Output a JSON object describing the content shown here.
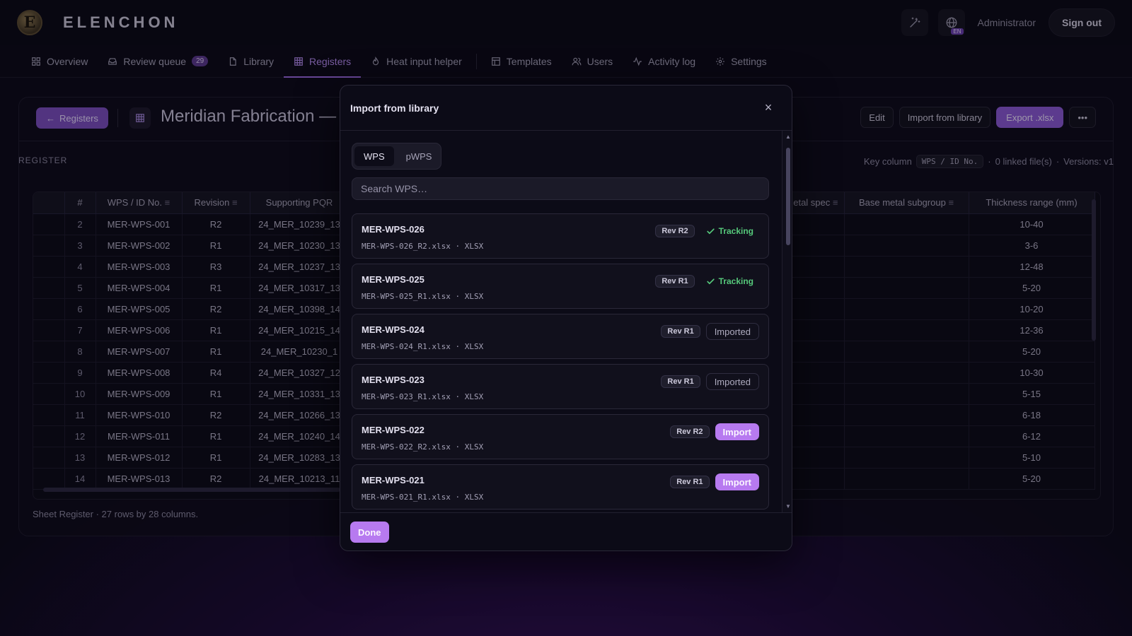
{
  "app": {
    "brand": "ELENCHON",
    "logo_letter": "E"
  },
  "topbar": {
    "lang_badge": "EN",
    "user": "Administrator",
    "sign_out": "Sign out"
  },
  "nav": {
    "overview": "Overview",
    "review_queue": "Review queue",
    "review_count": "29",
    "library": "Library",
    "registers": "Registers",
    "heat_input": "Heat input helper",
    "templates": "Templates",
    "users": "Users",
    "activity": "Activity log",
    "settings": "Settings"
  },
  "page": {
    "back": "Registers",
    "title": "Meridian Fabrication —",
    "edit": "Edit",
    "import_lib": "Import from library",
    "export": "Export .xlsx",
    "more": "•••",
    "register_label": "REGISTER",
    "key_column_label": "Key column",
    "key_column": "WPS / ID No.",
    "linked": "0 linked file(s)",
    "versions": "Versions: v1",
    "sheet_info": "Sheet Register · 27 rows by 28 columns."
  },
  "table": {
    "headers": [
      "#",
      "WPS / ID No.",
      "Revision",
      "Supporting PQR"
    ],
    "right_headers": [
      "etal spec",
      "Base metal subgroup",
      "Thickness range (mm)"
    ],
    "rows": [
      [
        "2",
        "MER-WPS-001",
        "R2",
        "24_MER_10239_13",
        "10-40"
      ],
      [
        "3",
        "MER-WPS-002",
        "R1",
        "24_MER_10230_13",
        "3-6"
      ],
      [
        "4",
        "MER-WPS-003",
        "R3",
        "24_MER_10237_13",
        "12-48"
      ],
      [
        "5",
        "MER-WPS-004",
        "R1",
        "24_MER_10317_13",
        "5-20"
      ],
      [
        "6",
        "MER-WPS-005",
        "R2",
        "24_MER_10398_14",
        "10-20"
      ],
      [
        "7",
        "MER-WPS-006",
        "R1",
        "24_MER_10215_14",
        "12-36"
      ],
      [
        "8",
        "MER-WPS-007",
        "R1",
        "24_MER_10230_1",
        "5-20"
      ],
      [
        "9",
        "MER-WPS-008",
        "R4",
        "24_MER_10327_12",
        "10-30"
      ],
      [
        "10",
        "MER-WPS-009",
        "R1",
        "24_MER_10331_13",
        "5-15"
      ],
      [
        "11",
        "MER-WPS-010",
        "R2",
        "24_MER_10266_13",
        "6-18"
      ],
      [
        "12",
        "MER-WPS-011",
        "R1",
        "24_MER_10240_14",
        "6-12"
      ],
      [
        "13",
        "MER-WPS-012",
        "R1",
        "24_MER_10283_13",
        "5-10"
      ],
      [
        "14",
        "MER-WPS-013",
        "R2",
        "24_MER_10213_11",
        "5-20"
      ]
    ]
  },
  "modal": {
    "title": "Import from library",
    "close": "×",
    "tab_wps": "WPS",
    "tab_pwps": "pWPS",
    "search_placeholder": "Search WPS…",
    "done": "Done",
    "items": [
      {
        "name": "MER-WPS-026",
        "file": "MER-WPS-026_R2.xlsx · XLSX",
        "rev": "Rev R2",
        "status": "Tracking"
      },
      {
        "name": "MER-WPS-025",
        "file": "MER-WPS-025_R1.xlsx · XLSX",
        "rev": "Rev R1",
        "status": "Tracking"
      },
      {
        "name": "MER-WPS-024",
        "file": "MER-WPS-024_R1.xlsx · XLSX",
        "rev": "Rev R1",
        "status": "Imported"
      },
      {
        "name": "MER-WPS-023",
        "file": "MER-WPS-023_R1.xlsx · XLSX",
        "rev": "Rev R1",
        "status": "Imported"
      },
      {
        "name": "MER-WPS-022",
        "file": "MER-WPS-022_R2.xlsx · XLSX",
        "rev": "Rev R2",
        "status": "Import"
      },
      {
        "name": "MER-WPS-021",
        "file": "MER-WPS-021_R1.xlsx · XLSX",
        "rev": "Rev R1",
        "status": "Import"
      }
    ]
  },
  "colors": {
    "accent": "#b77af0",
    "tracking": "#56c97b",
    "background": "#0b0a18"
  }
}
